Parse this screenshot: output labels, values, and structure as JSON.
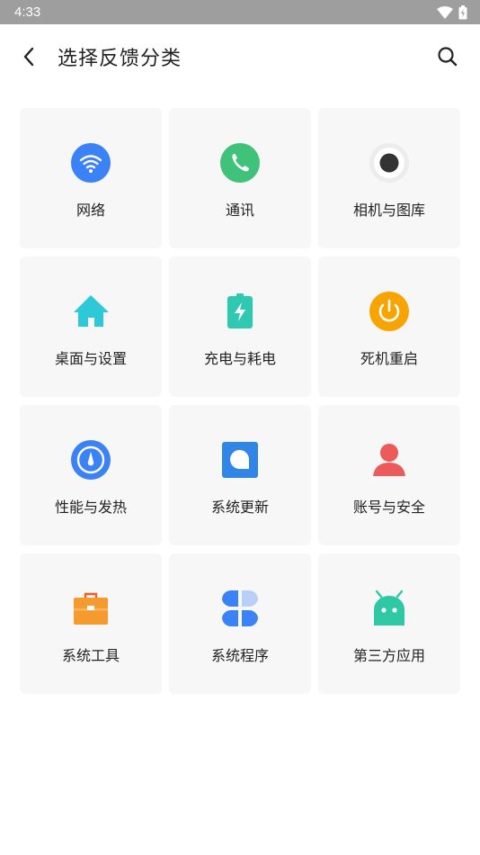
{
  "status_bar": {
    "time": "4:33"
  },
  "header": {
    "title": "选择反馈分类"
  },
  "categories": [
    {
      "label": "网络",
      "icon": "wifi-icon",
      "color": "#3b82f6"
    },
    {
      "label": "通讯",
      "icon": "phone-icon",
      "color": "#3fc27a"
    },
    {
      "label": "相机与图库",
      "icon": "camera-icon",
      "color": "#333333"
    },
    {
      "label": "桌面与设置",
      "icon": "home-icon",
      "color": "#2ec9d8"
    },
    {
      "label": "充电与耗电",
      "icon": "battery-charging-icon",
      "color": "#2ec9b0"
    },
    {
      "label": "死机重启",
      "icon": "power-icon",
      "color": "#f7a400"
    },
    {
      "label": "性能与发热",
      "icon": "gauge-icon",
      "color": "#3b82f6"
    },
    {
      "label": "系统更新",
      "icon": "system-update-icon",
      "color": "#2f86e6"
    },
    {
      "label": "账号与安全",
      "icon": "user-icon",
      "color": "#ec5a5a"
    },
    {
      "label": "系统工具",
      "icon": "toolbox-icon",
      "color": "#f59a2f"
    },
    {
      "label": "系统程序",
      "icon": "apps-icon",
      "color": "#3b82f6"
    },
    {
      "label": "第三方应用",
      "icon": "android-icon",
      "color": "#2ec9a4"
    }
  ]
}
